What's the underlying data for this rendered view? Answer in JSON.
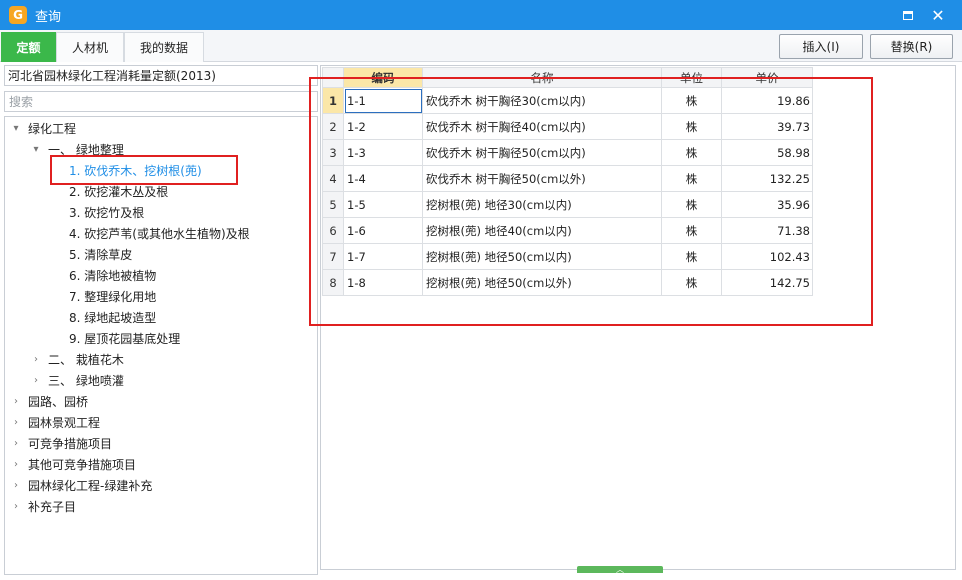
{
  "window": {
    "title": "查询",
    "logo_glyph": "G",
    "maximize_icon": "window-maximize-icon",
    "close_glyph": "✕",
    "accent_color": "#1f8ee6"
  },
  "tabs": [
    {
      "label": "定额",
      "active": true
    },
    {
      "label": "人材机",
      "active": false
    },
    {
      "label": "我的数据",
      "active": false
    }
  ],
  "toolbar": {
    "insert_label": "插入(I)",
    "replace_label": "替换(R)"
  },
  "left": {
    "quota_library": "河北省园林绿化工程消耗量定额(2013)",
    "search_placeholder": "搜索",
    "tree": [
      {
        "label": "绿化工程",
        "toggle": "▾"
      },
      {
        "label": "一、 绿地整理",
        "toggle": "▾"
      },
      {
        "label": "1. 砍伐乔木、挖树根(蔸)",
        "selected": true
      },
      {
        "label": "2. 砍挖灌木丛及根"
      },
      {
        "label": "3. 砍挖竹及根"
      },
      {
        "label": "4. 砍挖芦苇(或其他水生植物)及根"
      },
      {
        "label": "5. 清除草皮"
      },
      {
        "label": "6. 清除地被植物"
      },
      {
        "label": "7. 整理绿化用地"
      },
      {
        "label": "8. 绿地起坡造型"
      },
      {
        "label": "9. 屋顶花园基底处理"
      },
      {
        "label": "二、 栽植花木",
        "toggle": "›"
      },
      {
        "label": "三、 绿地喷灌",
        "toggle": "›"
      },
      {
        "label": "园路、园桥",
        "toggle": "›"
      },
      {
        "label": "园林景观工程",
        "toggle": "›"
      },
      {
        "label": "可竞争措施项目",
        "toggle": "›"
      },
      {
        "label": "其他可竞争措施项目",
        "toggle": "›"
      },
      {
        "label": "园林绿化工程-绿建补充",
        "toggle": "›"
      },
      {
        "label": "补充子目",
        "toggle": "›"
      }
    ]
  },
  "grid": {
    "headers": {
      "code": "编码",
      "name": "名称",
      "unit": "单位",
      "price": "单价"
    },
    "rows": [
      {
        "idx": "1",
        "code": "1-1",
        "name": "砍伐乔木 树干胸径30(cm以内)",
        "unit": "株",
        "price": "19.86"
      },
      {
        "idx": "2",
        "code": "1-2",
        "name": "砍伐乔木 树干胸径40(cm以内)",
        "unit": "株",
        "price": "39.73"
      },
      {
        "idx": "3",
        "code": "1-3",
        "name": "砍伐乔木 树干胸径50(cm以内)",
        "unit": "株",
        "price": "58.98"
      },
      {
        "idx": "4",
        "code": "1-4",
        "name": "砍伐乔木 树干胸径50(cm以外)",
        "unit": "株",
        "price": "132.25"
      },
      {
        "idx": "5",
        "code": "1-5",
        "name": "挖树根(蔸) 地径30(cm以内)",
        "unit": "株",
        "price": "35.96"
      },
      {
        "idx": "6",
        "code": "1-6",
        "name": "挖树根(蔸) 地径40(cm以内)",
        "unit": "株",
        "price": "71.38"
      },
      {
        "idx": "7",
        "code": "1-7",
        "name": "挖树根(蔸) 地径50(cm以内)",
        "unit": "株",
        "price": "102.43"
      },
      {
        "idx": "8",
        "code": "1-8",
        "name": "挖树根(蔸) 地径50(cm以外)",
        "unit": "株",
        "price": "142.75"
      }
    ]
  },
  "splitter_glyph": "︿"
}
